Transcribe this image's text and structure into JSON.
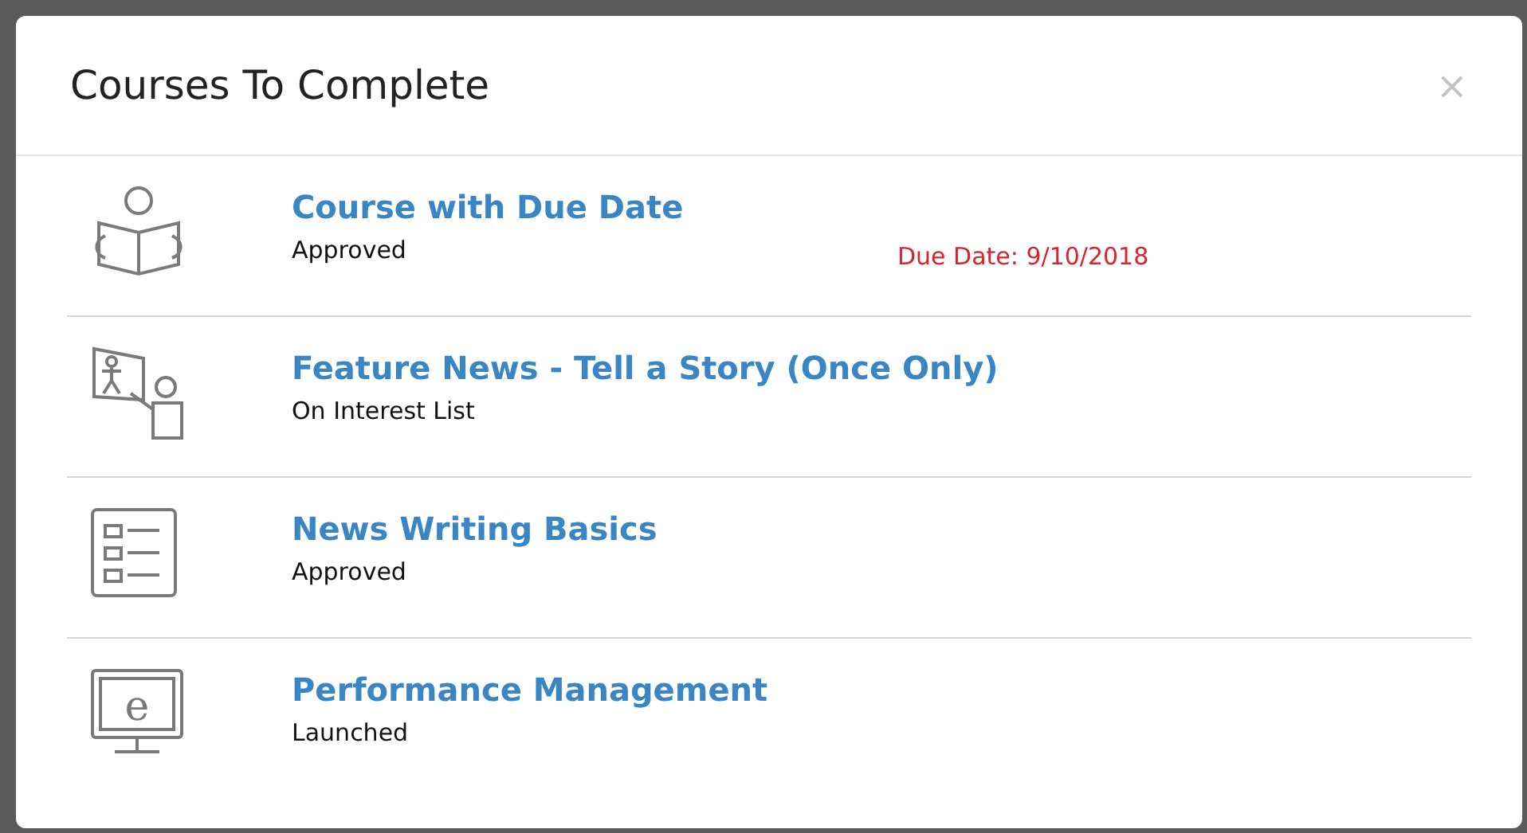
{
  "dialog": {
    "title": "Courses To Complete",
    "close": "×"
  },
  "courses": [
    {
      "kind": "reading",
      "title": "Course with Due Date",
      "status": "Approved",
      "due": "Due Date: 9/10/2018"
    },
    {
      "kind": "instructor",
      "title": "Feature News - Tell a Story (Once Only)",
      "status": "On Interest List"
    },
    {
      "kind": "checklist",
      "title": "News Writing Basics",
      "status": "Approved"
    },
    {
      "kind": "elearning",
      "icon_letter": "e",
      "title": "Performance Management",
      "status": "Launched"
    }
  ]
}
